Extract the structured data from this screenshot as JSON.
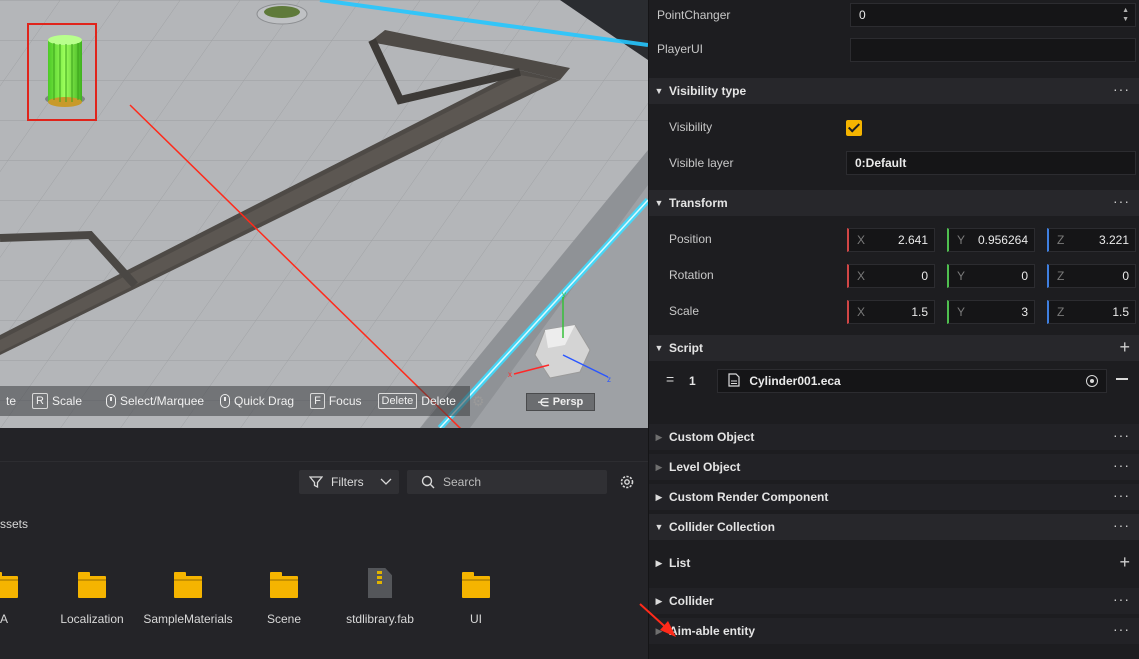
{
  "viewport": {
    "tools": [
      {
        "key": "R",
        "label": "Scale"
      },
      {
        "label": "Select/Marquee"
      },
      {
        "label": "Quick Drag"
      },
      {
        "key": "F",
        "label": "Focus"
      },
      {
        "key": "Delete",
        "label": "Delete"
      }
    ],
    "partial_tool_label": "te",
    "persp_label": "Persp",
    "gizmo_labels": {
      "x": "x",
      "y": "y",
      "z": "z"
    }
  },
  "assets": {
    "filters_label": "Filters",
    "search_placeholder": "Search",
    "path_label": "ssets",
    "items": [
      {
        "name": "A",
        "type": "folder"
      },
      {
        "name": "Localization",
        "type": "folder"
      },
      {
        "name": "SampleMaterials",
        "type": "folder"
      },
      {
        "name": "Scene",
        "type": "folder"
      },
      {
        "name": "stdlibrary.fab",
        "type": "file"
      },
      {
        "name": "UI",
        "type": "folder"
      }
    ]
  },
  "inspector": {
    "point_changer": {
      "label": "PointChanger",
      "value": "0"
    },
    "player_ui": {
      "label": "PlayerUI",
      "value": ""
    },
    "visibility_type": {
      "title": "Visibility type",
      "visibility_label": "Visibility",
      "visibility_checked": true,
      "visible_layer_label": "Visible layer",
      "visible_layer_value": "0:Default"
    },
    "transform": {
      "title": "Transform",
      "position": {
        "label": "Position",
        "x": "2.641",
        "y": "0.956264",
        "z": "3.221"
      },
      "rotation": {
        "label": "Rotation",
        "x": "0",
        "y": "0",
        "z": "0"
      },
      "scale": {
        "label": "Scale",
        "x": "1.5",
        "y": "3",
        "z": "1.5"
      },
      "axis_x": "X",
      "axis_y": "Y",
      "axis_z": "Z"
    },
    "script": {
      "title": "Script",
      "index": "1",
      "file": "Cylinder001.eca"
    },
    "sections": {
      "custom_object": "Custom Object",
      "level_object": "Level Object",
      "custom_render": "Custom Render Component",
      "collider_collection": "Collider Collection",
      "list": "List",
      "collider": "Collider",
      "aimable": "Aim-able entity"
    },
    "more_glyph": "···",
    "plus_glyph": "+"
  }
}
